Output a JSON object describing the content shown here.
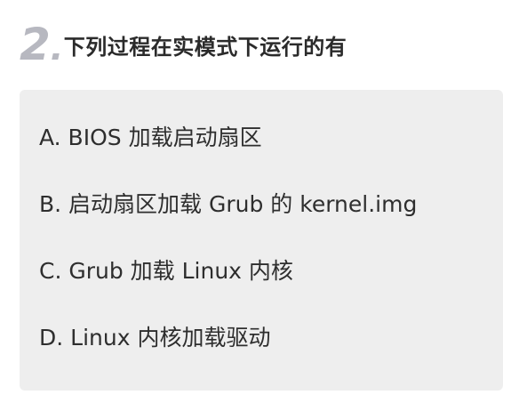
{
  "question": {
    "number": "2",
    "title": "下列过程在实模式下运行的有"
  },
  "options": [
    {
      "text": "A. BIOS 加载启动扇区"
    },
    {
      "text": "B. 启动扇区加载 Grub 的 kernel.img"
    },
    {
      "text": "C. Grub 加载 Linux 内核"
    },
    {
      "text": "D. Linux 内核加载驱动"
    }
  ],
  "colors": {
    "number": "#b7b8c0",
    "title": "#2b2b2b",
    "panel": "#eeeeee",
    "option_text": "#2e2e2e"
  }
}
